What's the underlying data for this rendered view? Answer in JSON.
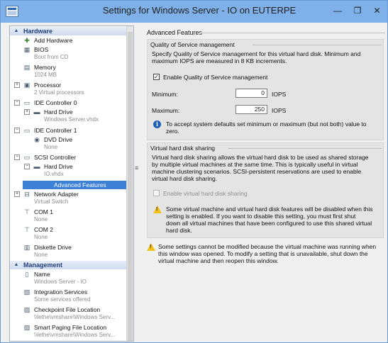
{
  "window": {
    "title": "Settings for Windows Server - IO on EUTERPE",
    "min_label": "—",
    "max_label": "❐",
    "close_label": "✕"
  },
  "sidebar": {
    "hardware_label": "Hardware",
    "management_label": "Management",
    "add_hardware": "Add Hardware",
    "bios": "BIOS",
    "bios_sub": "Boot from CD",
    "memory": "Memory",
    "memory_sub": "1024 MB",
    "processor": "Processor",
    "processor_sub": "2 Virtual processors",
    "ide0": "IDE Controller 0",
    "ide0_hd": "Hard Drive",
    "ide0_hd_sub": "Windows Server.vhdx",
    "ide1": "IDE Controller 1",
    "ide1_dvd": "DVD Drive",
    "ide1_dvd_sub": "None",
    "scsi": "SCSI Controller",
    "scsi_hd": "Hard Drive",
    "scsi_hd_sub": "IO.vhdx",
    "advanced_features": "Advanced Features",
    "network": "Network Adapter",
    "network_sub": "Virtual Switch",
    "com1": "COM 1",
    "com1_sub": "None",
    "com2": "COM 2",
    "com2_sub": "None",
    "diskette": "Diskette Drive",
    "diskette_sub": "None",
    "name": "Name",
    "name_sub": "Windows Server - IO",
    "integration": "Integration Services",
    "integration_sub": "Some services offered",
    "checkpoint": "Checkpoint File Location",
    "checkpoint_sub": "\\\\lethe\\vmshare\\Windows Serv...",
    "smartpaging": "Smart Paging File Location",
    "smartpaging_sub": "\\\\lethe\\vmshare\\Windows Serv..."
  },
  "main": {
    "title": "Advanced Features",
    "qos": {
      "group_title": "Quality of Service management",
      "desc1": "Specify Quality of Service management for this virtual hard disk. Minimum and",
      "desc2": "maximum IOPS are measured in 8 KB increments.",
      "enable_label": "Enable Quality of Service management",
      "enable_check": "✓",
      "min_label": "Minimum:",
      "min_value": "0",
      "max_label": "Maximum:",
      "max_value": "250",
      "unit": "IOPS",
      "info1": "To accept system defaults set minimum or maximum (but not both) value to",
      "info2": "zero."
    },
    "sharing": {
      "group_title": "Virtual hard disk sharing",
      "desc1": "Virtual hard disk sharing allows the virtual hard disk to be used as shared storage",
      "desc2": "by multiple virtual machines at the same time. This is typically useful in virtual",
      "desc3": "machine clustering scenarios. SCSI-persistent reservations are used to enable",
      "desc4": "virtual hard disk sharing.",
      "enable_label": "Enable virtual hard disk sharing",
      "warn1": "Some virtual machine and virtual hard disk features will be disabled when this",
      "warn2": "setting is enabled. If you want to disable this setting, you must first shut",
      "warn3": "down all virtual machines that have been configured to use this shared virtual",
      "warn4": "hard disk."
    },
    "bottom_warning": {
      "line1": "Some settings cannot be modified because the virtual machine was running when",
      "line2": "this window was opened. To modify a setting that is unavailable, shut down the",
      "line3": "virtual machine and then reopen this window."
    }
  }
}
